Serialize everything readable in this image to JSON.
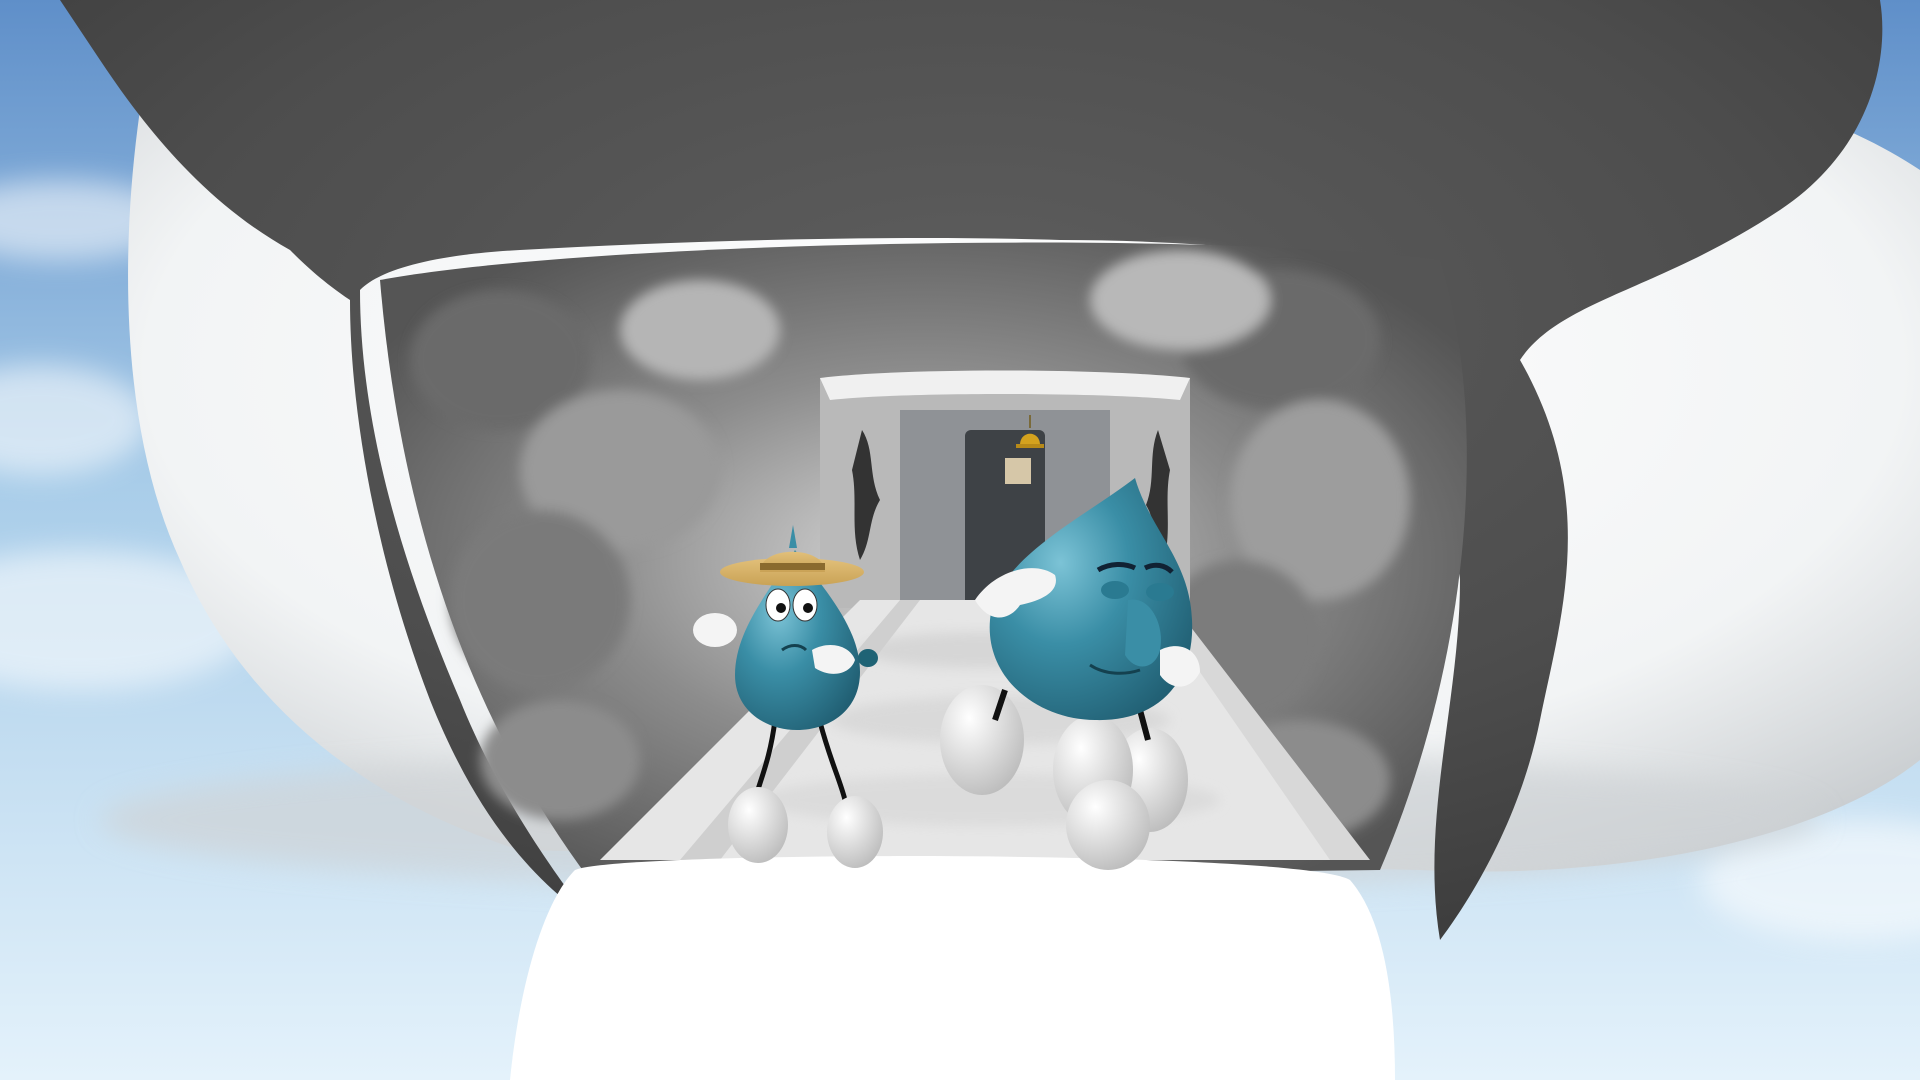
{
  "scene": {
    "colors": {
      "sky_top": "#5f8fc9",
      "sky_mid": "#a9cde9",
      "sky_bottom": "#e4f2fb",
      "cloud_white": "#f2f4f5",
      "cloud_shadow": "#c9cdd0",
      "cloud_dark": "#4d4d4d",
      "cloud_darker": "#3a3a3a",
      "tunnel_grey": "#8c8c8c",
      "floor": "#e6e6e6",
      "drop_blue": "#3a8ea6",
      "drop_blue_dark": "#215f73",
      "drop_highlight": "#7cc3d6",
      "hat_gold": "#c9a255",
      "hat_band": "#8a6a2e",
      "bell_gold": "#d4a21e",
      "glove_white": "#f4f4f4",
      "shoe_white": "#ededed",
      "door_dark": "#3e4246"
    },
    "characters": [
      {
        "name": "small-drop-with-hat",
        "expression": "worried"
      },
      {
        "name": "large-drop",
        "expression": "sleepy"
      }
    ]
  }
}
